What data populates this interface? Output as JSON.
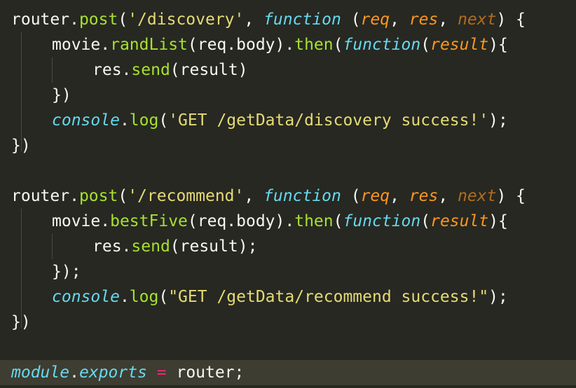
{
  "code": {
    "router1": {
      "router": "router",
      "dot": ".",
      "post": "post",
      "open": "(",
      "path": "'/discovery'",
      "comma": ", ",
      "function": "function",
      "sp": " ",
      "paren": "(",
      "req": "req",
      "c1": ", ",
      "res": "res",
      "c2": ", ",
      "next": "next",
      "close": ") {"
    },
    "line2": {
      "movie": "movie",
      "dot": ".",
      "method": "randList",
      "args": "(req.body).",
      "then": "then",
      "open": "(",
      "function": "function",
      "paren": "(",
      "result": "result",
      "close": "){"
    },
    "line3": {
      "res": "res",
      "dot": ".",
      "send": "send",
      "args": "(result)"
    },
    "line4": {
      "text": "})"
    },
    "line5": {
      "console": "console",
      "dot": ".",
      "log": "log",
      "open": "(",
      "msg": "'GET /getData/discovery success!'",
      "close": ");"
    },
    "line6": {
      "text": "})"
    },
    "router2": {
      "router": "router",
      "dot": ".",
      "post": "post",
      "open": "(",
      "path": "'/recommend'",
      "comma": ", ",
      "function": "function",
      "sp": " ",
      "paren": "(",
      "req": "req",
      "c1": ", ",
      "res": "res",
      "c2": ", ",
      "next": "next",
      "close": ") {"
    },
    "line9": {
      "movie": "movie",
      "dot": ".",
      "method": "bestFive",
      "args": "(req.body).",
      "then": "then",
      "open": "(",
      "function": "function",
      "paren": "(",
      "result": "result",
      "close": "){"
    },
    "line10": {
      "res": "res",
      "dot": ".",
      "send": "send",
      "args": "(result);"
    },
    "line11": {
      "text": "});"
    },
    "line12": {
      "console": "console",
      "dot": ".",
      "log": "log",
      "open": "(",
      "msg": "\"GET /getData/recommend success!\"",
      "close": ");"
    },
    "line13": {
      "text": "})"
    },
    "line15": {
      "module": "module",
      "dot": ".",
      "exports": "exports",
      "sp1": " ",
      "eq": "=",
      "sp2": " ",
      "router": "router;"
    }
  },
  "colors": {
    "background": "#272822",
    "current_line": "#3E3D32",
    "text": "#F8F8F2",
    "function_name": "#A6E22E",
    "string": "#E6DB74",
    "keyword": "#66D9EF",
    "parameter": "#FD971F",
    "operator": "#F92672"
  }
}
